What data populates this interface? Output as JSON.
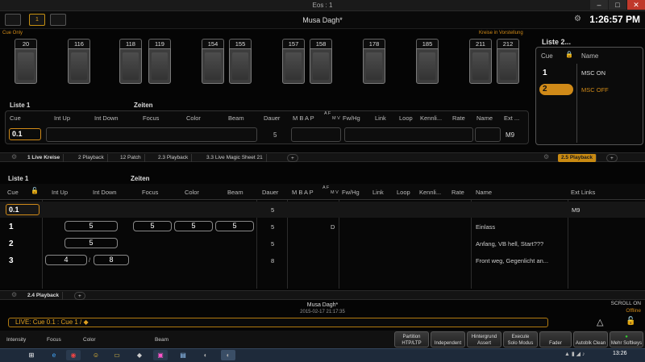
{
  "window": {
    "title": "Eos : 1"
  },
  "header": {
    "show_name": "Musa Dagh*",
    "clock": "1:26:57 PM",
    "icon_button_label": "1"
  },
  "live": {
    "cue_only": "Cue Only",
    "kreise_label": "Kreise in Vorstellung",
    "channels": [
      "20",
      "116",
      "118",
      "119",
      "154",
      "155",
      "157",
      "158",
      "178",
      "185",
      "211",
      "212"
    ],
    "list_title": "Liste 1",
    "zeiten": "Zeiten",
    "headers": [
      "Cue",
      "Int Up",
      "Int Down",
      "Focus",
      "Color",
      "Beam",
      "Dauer",
      "M B A P",
      "A F",
      "M V",
      "Fw/Hg",
      "Link",
      "Loop",
      "Kennli...",
      "Rate",
      "Name",
      "Ext ..."
    ],
    "cue": "0.1",
    "dauer": "5",
    "ext": "M9"
  },
  "cuelist_popup": {
    "title": "Liste 2...",
    "col_cue": "Cue",
    "col_name": "Name",
    "rows": [
      {
        "cue": "1",
        "name": "MSC ON"
      },
      {
        "cue": "2",
        "name": "MSC OFF"
      }
    ]
  },
  "tabs_top": [
    "1 Live Kreise",
    "2 Playback",
    "12 Patch",
    "2.3 Playback",
    "3.3 Live Magic Sheet 21",
    "+"
  ],
  "tab_right": "2.5 Playback",
  "playback": {
    "list_title": "Liste 1",
    "zeiten": "Zeiten",
    "headers": [
      "Cue",
      "Int Up",
      "Int Down",
      "Focus",
      "Color",
      "Beam",
      "Dauer",
      "M B A P",
      "A F",
      "M V",
      "Fw/Hg",
      "Link",
      "Loop",
      "Kennli...",
      "Rate",
      "Name",
      "Ext Links"
    ],
    "rows": [
      {
        "cue": "0.1",
        "int_up": "",
        "int_down": "",
        "focus": "",
        "color": "",
        "beam": "",
        "dauer": "5",
        "flag": "",
        "name": "",
        "ext": "M9"
      },
      {
        "cue": "1",
        "int_up": "5",
        "int_down": "",
        "focus": "5",
        "color": "5",
        "beam": "5",
        "dauer": "5",
        "flag": "D",
        "name": "Einlass",
        "ext": ""
      },
      {
        "cue": "2",
        "int_up": "5",
        "int_down": "",
        "focus": "",
        "color": "",
        "beam": "",
        "dauer": "5",
        "flag": "",
        "name": "Anfang, VB hell, Start???",
        "ext": ""
      },
      {
        "cue": "3",
        "int_up": "4",
        "int_down": "8",
        "focus": "",
        "color": "",
        "beam": "",
        "dauer": "8",
        "flag": "",
        "name": "Front weg, Gegenlicht an...",
        "ext": ""
      }
    ],
    "slash": "/"
  },
  "tabs_bottom": [
    "2.4 Playback",
    "+"
  ],
  "status": {
    "show": "Musa Dagh*",
    "date": "2015-02-17 21:17:35",
    "scroll": "SCROLL ON",
    "offline": "Offline"
  },
  "command_line": "LIVE: Cue  0.1 : Cue 1 / ◆",
  "softkeys_left": [
    "Intensity",
    "Focus",
    "Color",
    "Beam"
  ],
  "softkeys_right": [
    {
      "l1": "Partition",
      "l2": "HTP/LTP"
    },
    {
      "l1": "",
      "l2": "Independent"
    },
    {
      "l1": "Hintergrund",
      "l2": "Assert"
    },
    {
      "l1": "Execute",
      "l2": "Solo Modus"
    },
    {
      "l1": "",
      "l2": "Fader"
    },
    {
      "l1": "",
      "l2": "Autoblk Clean"
    },
    {
      "l1": "",
      "l2": "Mehr Softkeys"
    }
  ],
  "taskbar": {
    "time": "13:26"
  }
}
